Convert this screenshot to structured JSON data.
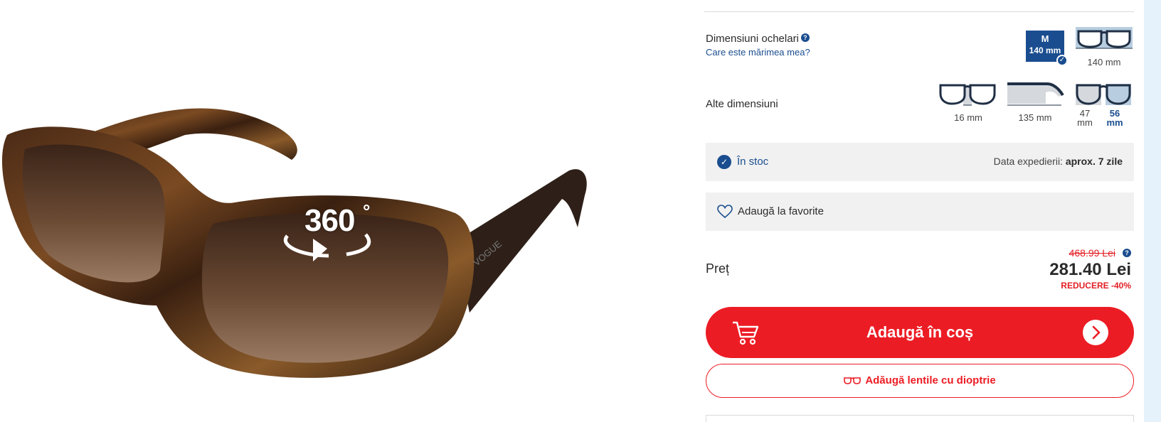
{
  "product": {
    "image_alt": "Vogue sunglasses tortoise frame with brown gradient lenses",
    "badge_360": "360",
    "badge_deg": "°"
  },
  "sizes": {
    "label": "Dimensiuni ochelari",
    "help": "?",
    "link": "Care este mărimea mea?",
    "selected": {
      "code": "M",
      "value": "140 mm",
      "check": "✓"
    },
    "width_caption": "140 mm"
  },
  "other_sizes": {
    "label": "Alte dimensiuni",
    "bridge": "16 mm",
    "temple": "135 mm",
    "lens_height_value": "47",
    "lens_height_unit": "mm",
    "lens_width_value": "56",
    "lens_width_unit": "mm"
  },
  "stock": {
    "check": "✓",
    "status": "În stoc",
    "ship_label": "Data expedierii:",
    "ship_value": "aprox. 7 zile"
  },
  "favorites": {
    "label": "Adaugă la favorite",
    "icon": "heart-outline-icon"
  },
  "price": {
    "label": "Preț",
    "old": "468.99 Lei",
    "help": "?",
    "current": "281.40 Lei",
    "discount": "REDUCERE -40%"
  },
  "actions": {
    "add_to_cart": "Adaugă în coș",
    "add_lenses": "Adăugă lentile cu dioptrie"
  },
  "colors": {
    "brand_blue": "#1a4d8f",
    "cta_red": "#ec1c24",
    "panel_grey": "#f1f1f1"
  }
}
